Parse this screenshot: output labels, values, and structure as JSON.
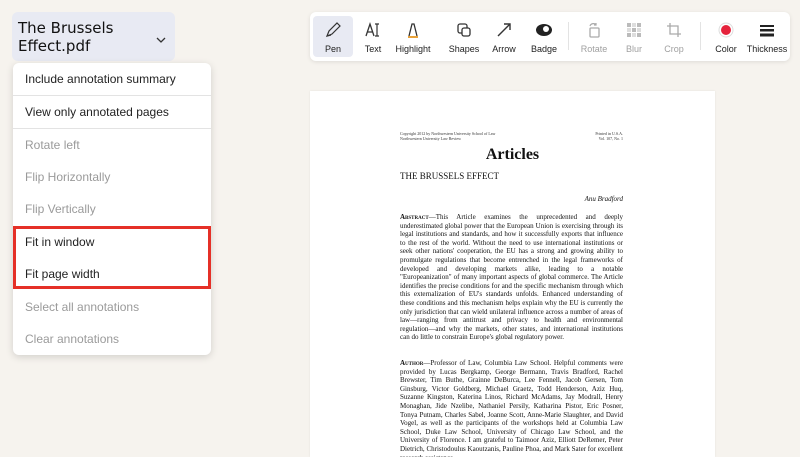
{
  "file": {
    "name": "The Brussels Effect.pdf"
  },
  "menu": {
    "items": [
      {
        "label": "Include annotation summary",
        "enabled": true
      },
      {
        "label": "View only annotated pages",
        "enabled": true
      },
      {
        "label": "Rotate left",
        "enabled": false
      },
      {
        "label": "Flip Horizontally",
        "enabled": false
      },
      {
        "label": "Flip Vertically",
        "enabled": false
      },
      {
        "label": "Fit in window",
        "enabled": true
      },
      {
        "label": "Fit page width",
        "enabled": true
      },
      {
        "label": "Select all annotations",
        "enabled": false
      },
      {
        "label": "Clear annotations",
        "enabled": false
      }
    ]
  },
  "toolbar": {
    "tools": [
      {
        "label": "Pen",
        "icon": "pen-icon",
        "active": true
      },
      {
        "label": "Text",
        "icon": "text-icon"
      },
      {
        "label": "Highlight",
        "icon": "highlight-icon"
      },
      {
        "label": "Shapes",
        "icon": "shapes-icon"
      },
      {
        "label": "Arrow",
        "icon": "arrow-icon"
      },
      {
        "label": "Badge",
        "icon": "badge-icon"
      },
      {
        "label": "Rotate",
        "icon": "rotate-icon",
        "disabled": true
      },
      {
        "label": "Blur",
        "icon": "blur-icon",
        "disabled": true
      },
      {
        "label": "Crop",
        "icon": "crop-icon",
        "disabled": true
      },
      {
        "label": "Color",
        "icon": "color-dot-icon"
      },
      {
        "label": "Thickness",
        "icon": "thickness-icon"
      }
    ],
    "color_value": "#e5233c"
  },
  "document": {
    "header_left": [
      "Copyright 2012 by Northwestern University School of Law",
      "Northwestern University Law Review"
    ],
    "header_right": [
      "Printed in U.S.A.",
      "Vol. 107, No. 1"
    ],
    "title": "Articles",
    "subtitle": "THE BRUSSELS EFFECT",
    "author": "Anu Bradford",
    "abstract_label": "Abstract",
    "abstract_text": "—This Article examines the unprecedented and deeply underestimated global power that the European Union is exercising through its legal institutions and standards, and how it successfully exports that influence to the rest of the world. Without the need to use international institutions or seek other nations' cooperation, the EU has a strong and growing ability to promulgate regulations that become entrenched in the legal frameworks of developed and developing markets alike, leading to a notable \"Europeanization\" of many important aspects of global commerce. The Article identifies the precise conditions for and the specific mechanism through which this externalization of EU's standards unfolds. Enhanced understanding of these conditions and this mechanism helps explain why the EU is currently the only jurisdiction that can wield unilateral influence across a number of areas of law—ranging from antitrust and privacy to health and environmental regulation—and why the markets, other states, and international institutions can do little to constrain Europe's global regulatory power.",
    "author_label": "Author",
    "author_text": "—Professor of Law, Columbia Law School. Helpful comments were provided by Lucas Bergkamp, George Bermann, Travis Bradford, Rachel Brewster, Tim Buthe, Grainne DeBurca, Lee Fennell, Jacob Gersen, Tom Ginsburg, Victor Goldberg, Michael Graetz, Todd Henderson, Aziz Huq, Suzanne Kingston, Katerina Linos, Richard McAdams, Jay Modrall, Henry Monaghan, Jide Nzelibe, Nathaniel Persily, Katharina Pistor, Eric Posner, Tonya Putnam, Charles Sabel, Joanne Scott, Anne-Marie Slaughter, and David Vogel, as well as the participants of the workshops held at Columbia Law School, Duke Law School, University of Chicago Law School, and the University of Florence. I am grateful to Taimoor Aziz, Elliott DeRemer, Peter Dietrich, Christodoulus Kaoutzanis, Pauline Phoa, and Mark Sater for excellent research assistance."
  }
}
